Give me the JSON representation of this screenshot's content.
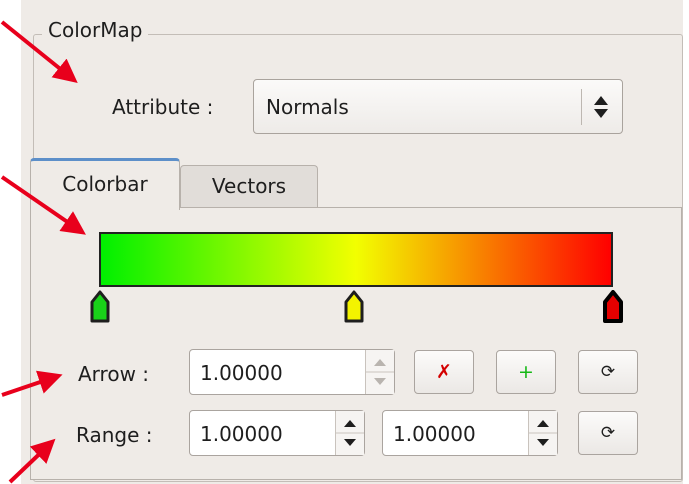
{
  "colormap": {
    "group_title": "ColorMap",
    "attribute_label": "Attribute :",
    "attribute_value": "Normals"
  },
  "tabs": [
    {
      "label": "Colorbar",
      "active": true
    },
    {
      "label": "Vectors",
      "active": false
    }
  ],
  "colorbar": {
    "gradient_colors": [
      "#00f000",
      "#f2ff00",
      "#ff0000"
    ],
    "handles": [
      {
        "color": "#19d219",
        "outline": "#1e1e1e"
      },
      {
        "color": "#f3f300",
        "outline": "#1e1e1e"
      },
      {
        "color": "#e60000",
        "outline": "#000000"
      }
    ]
  },
  "arrow_row": {
    "label": "Arrow :",
    "value": "1.00000",
    "remove_label": "✗",
    "add_label": "+",
    "reset_label": "⟳"
  },
  "range_row": {
    "label": "Range :",
    "min_value": "1.00000",
    "max_value": "1.00000",
    "reset_label": "⟳"
  },
  "annotation_color": "#e8001c"
}
